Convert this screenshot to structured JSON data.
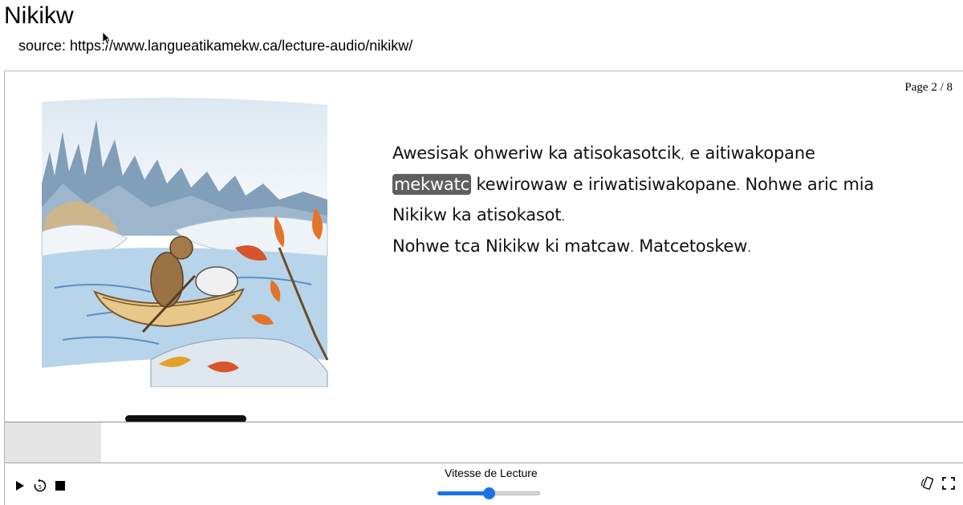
{
  "title": "Nikikw",
  "source": "source: https://www.langueatikamekw.ca/lecture-audio/nikikw/",
  "reader": {
    "page_counter": "Page 2 / 8",
    "story": {
      "line1_a": "Awesisak ohweriw ka atisokasotcik",
      "line1_b": "e aitiwakopane",
      "highlighted_word": "mekwatc",
      "line2_a": "kewirowaw e iriwatisiwakopane",
      "line2_b": "Nohwe aric mia",
      "line3": "Nikikw ka atisokasot",
      "line4_a": "Nohwe tca Nikikw ki matcaw",
      "line4_b": "Matcetoskew",
      "comma": ",",
      "period": "."
    },
    "progress": 0.1,
    "speed_label": "Vitesse de Lecture",
    "speed_value": 0.5
  },
  "icons": {
    "play": "play-icon",
    "replay": "replay-5-icon",
    "stop": "stop-icon",
    "rotate": "rotate-device-icon",
    "fullscreen": "fullscreen-icon"
  },
  "colors": {
    "highlight": "#5f5f5f",
    "slider": "#1a73e8"
  }
}
